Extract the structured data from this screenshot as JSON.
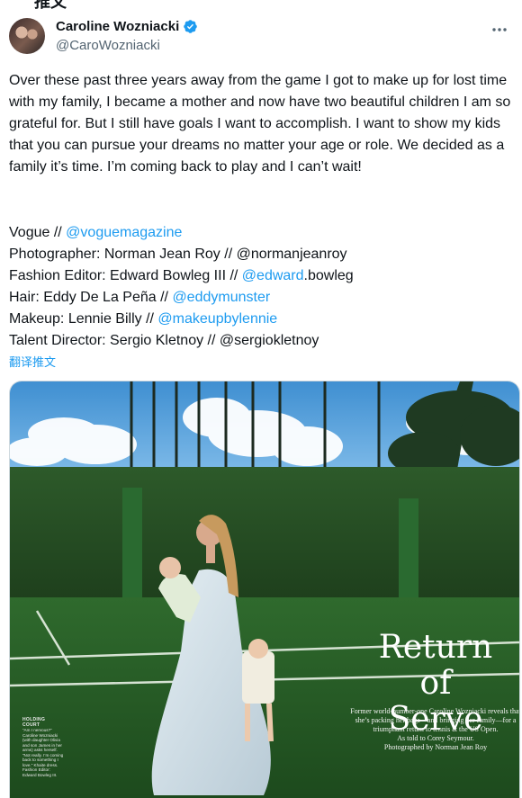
{
  "tweet": {
    "author": {
      "name": "Caroline Wozniacki",
      "handle": "@CaroWozniacki",
      "verified": true
    },
    "text": "Over these past three years away from the game I got to make up for lost time with my family, I became a mother and now have two beautiful children I am so grateful for. But I still have goals I want to accomplish. I want to show my kids that you can pursue your dreams no matter your age or role. We decided as a family it’s time. I’m coming back to play and I can’t wait!",
    "credits": [
      {
        "prefix": "Vogue // ",
        "mention": "@voguemagazine",
        "suffix": ""
      },
      {
        "prefix": "Photographer: Norman Jean Roy // @normanjeanroy",
        "mention": "",
        "suffix": ""
      },
      {
        "prefix": "Fashion Editor: Edward Bowleg III // ",
        "mention": "@edward",
        "suffix": ".bowleg"
      },
      {
        "prefix": "Hair: Eddy De La Peña // ",
        "mention": "@eddymunster",
        "suffix": ""
      },
      {
        "prefix": "Makeup: Lennie Billy // ",
        "mention": "@makeupbylennie",
        "suffix": ""
      },
      {
        "prefix": "Talent Director: Sergio Kletnoy // @sergiokletnoy",
        "mention": "",
        "suffix": ""
      }
    ],
    "translate_label": "翻译推文"
  },
  "media": {
    "headline_line1": "Return of",
    "headline_line2": "Serve",
    "subhead": "Former world-number-one Caroline Wozniacki reveals that she’s packing her bags—and bringing her family—for a triumphant return to tennis at the US Open.",
    "as_told": "As told to Corey Seymour.",
    "photo_credit": "Photographed by Norman Jean Roy",
    "side_caption_title": "HOLDING COURT",
    "side_caption": "“Am I nervous?” Caroline Wozniacki (with daughter Olivia and son James in her arms) asks herself. “Not really. I’m coming back to something I love.” Khaite dress. Fashion Editor: Edward Bowleg III."
  },
  "colors": {
    "accent": "#1d9bf0",
    "text": "#0f1419",
    "muted": "#536471"
  },
  "icons": [
    "verified-badge-icon",
    "more-options-icon"
  ]
}
